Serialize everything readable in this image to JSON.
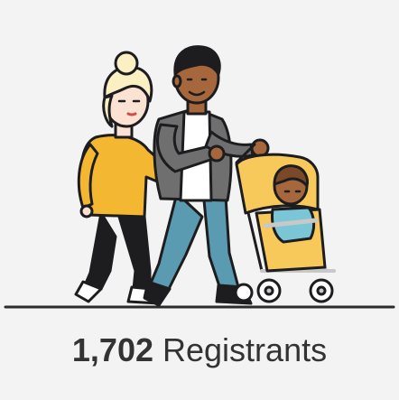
{
  "stat": {
    "value": "1,702",
    "label": "Registrants"
  },
  "illustration": {
    "subject": "family-walking-with-stroller",
    "colors": {
      "background": "#f3f3f3",
      "outline": "#1d1d1f",
      "skin_light": "#fbe2d2",
      "skin_dark": "#a5673b",
      "hair_blonde": "#fbefc4",
      "sweater": "#f4b731",
      "trousers_dark": "#1d1d1f",
      "jeans": "#5b9bb1",
      "shirt_grey": "#6f6f70",
      "stroller_yellow": "#f6c95a",
      "stroller_frame": "#c8c8c8",
      "baby_onesie": "#7bc6d6",
      "ground_line": "#2b2b2b"
    }
  }
}
